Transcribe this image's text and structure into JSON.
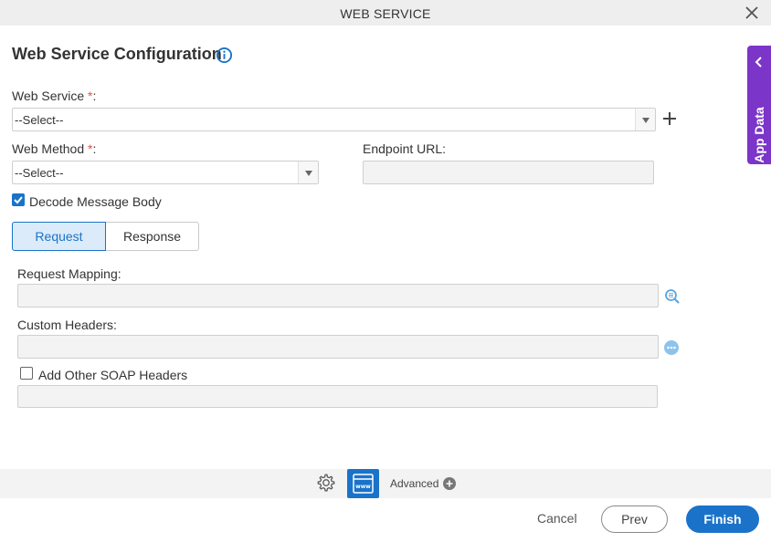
{
  "window": {
    "title": "WEB SERVICE",
    "close_icon": "close-icon"
  },
  "header": {
    "title": "Web Service Configuration",
    "info_icon": "info-icon"
  },
  "form": {
    "web_service": {
      "label": "Web Service",
      "required_mark": "*",
      "suffix": ":",
      "value": "--Select--"
    },
    "web_method": {
      "label": "Web Method",
      "required_mark": "*",
      "suffix": ":",
      "value": "--Select--"
    },
    "endpoint_url": {
      "label": "Endpoint URL:",
      "value": ""
    },
    "decode_message_body": {
      "label": "Decode Message Body",
      "checked": true
    },
    "tabs": [
      {
        "label": "Request",
        "active": true
      },
      {
        "label": "Response",
        "active": false
      }
    ],
    "request_mapping": {
      "label": "Request Mapping:",
      "value": ""
    },
    "custom_headers": {
      "label": "Custom Headers:",
      "value": ""
    },
    "add_other_soap_headers": {
      "label": "Add Other SOAP Headers",
      "checked": false,
      "value": ""
    }
  },
  "side_panel": {
    "label": "App Data"
  },
  "footer": {
    "advanced_label": "Advanced",
    "cancel_label": "Cancel",
    "prev_label": "Prev",
    "finish_label": "Finish"
  },
  "colors": {
    "accent": "#1a73c9",
    "app_data": "#7b35c9",
    "required": "#d9534f"
  }
}
